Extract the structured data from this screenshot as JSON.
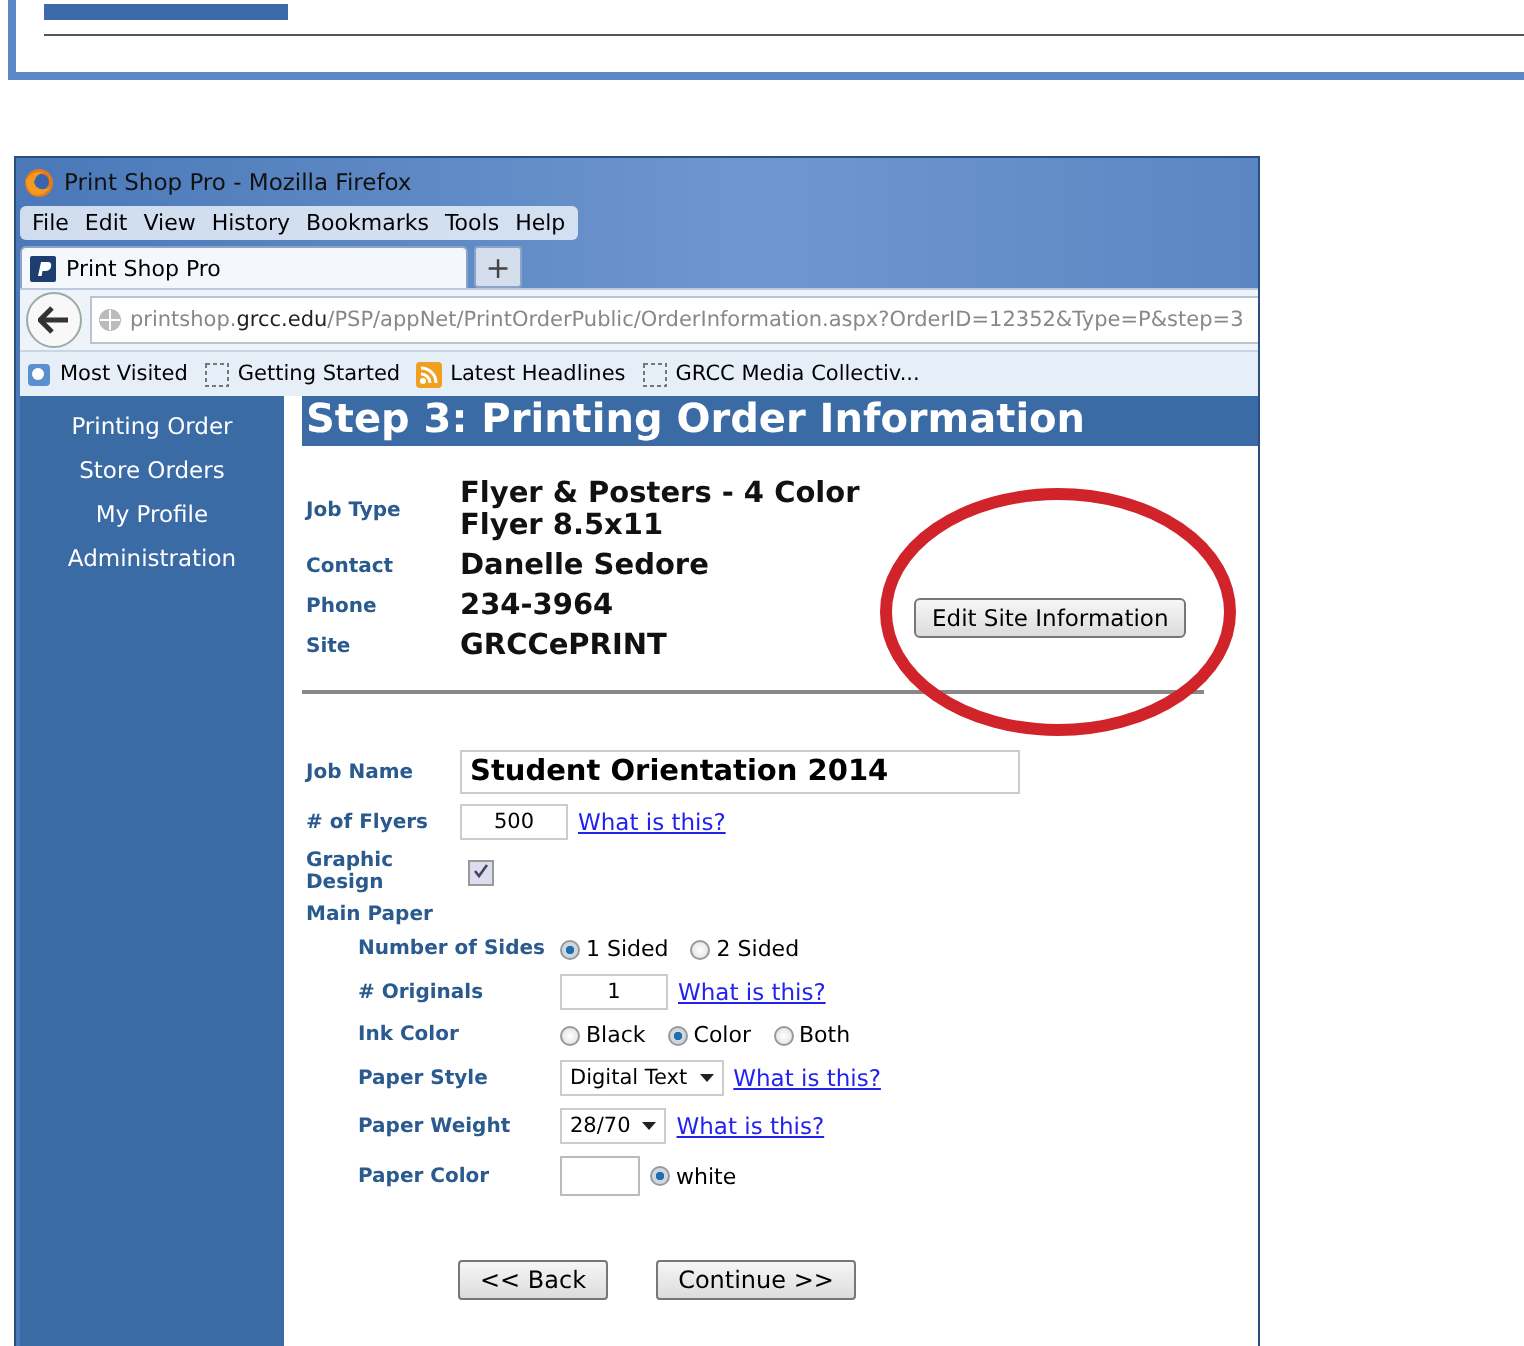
{
  "window": {
    "title": "Print Shop Pro - Mozilla Firefox"
  },
  "menu": [
    {
      "label": "File"
    },
    {
      "label": "Edit"
    },
    {
      "label": "View"
    },
    {
      "label": "History"
    },
    {
      "label": "Bookmarks"
    },
    {
      "label": "Tools"
    },
    {
      "label": "Help"
    }
  ],
  "tabs": [
    {
      "label": "Print Shop Pro",
      "selected": true
    }
  ],
  "new_tab": "+",
  "address": {
    "prefix": "printshop.",
    "domain": "grcc.edu",
    "path": "/PSP/appNet/PrintOrderPublic/OrderInformation.aspx?OrderID=12352&Type=P&step=3"
  },
  "bookmarks": [
    {
      "label": "Most Visited",
      "kind": "site"
    },
    {
      "label": "Getting Started",
      "kind": "page"
    },
    {
      "label": "Latest Headlines",
      "kind": "feed"
    },
    {
      "label": "GRCC Media Collectiv...",
      "kind": "page"
    }
  ],
  "sidebar": {
    "items": [
      "Printing Order",
      "Store Orders",
      "My Profile",
      "Administration"
    ]
  },
  "heading": "Step 3: Printing Order Information",
  "info": [
    {
      "label": "Job Type",
      "lines": [
        "Flyer & Posters - 4 Color",
        "Flyer 8.5x11"
      ]
    },
    {
      "label": "Contact",
      "lines": [
        "Danelle Sedore"
      ]
    },
    {
      "label": "Phone",
      "lines": [
        "234-3964"
      ]
    },
    {
      "label": "Site",
      "lines": [
        "GRCCePRINT"
      ]
    }
  ],
  "edit_site_button": "Edit Site Information",
  "form": [
    {
      "kind": "big_text",
      "label": "Job Name",
      "value": "Student Orientation 2014"
    },
    {
      "kind": "number",
      "label": "# of Flyers",
      "value": "500",
      "link": "What is this?"
    },
    {
      "kind": "checkbox",
      "label": "Graphic Design",
      "checked": true
    },
    {
      "kind": "section",
      "label": "Main Paper",
      "children": [
        {
          "kind": "radio",
          "label": "Number of Sides",
          "options": [
            {
              "label": "1 Sided",
              "selected": true
            },
            {
              "label": "2 Sided",
              "selected": false
            }
          ]
        },
        {
          "kind": "number",
          "label": "# Originals",
          "value": "1",
          "link": "What is this?"
        },
        {
          "kind": "radio",
          "label": "Ink Color",
          "options": [
            {
              "label": "Black",
              "selected": false
            },
            {
              "label": "Color",
              "selected": true
            },
            {
              "label": "Both",
              "selected": false
            }
          ]
        },
        {
          "kind": "select",
          "label": "Paper Style",
          "value": "Digital Text",
          "link": "What is this?"
        },
        {
          "kind": "select",
          "label": "Paper Weight",
          "value": "28/70",
          "link": "What is this?"
        },
        {
          "kind": "color",
          "label": "Paper Color",
          "options": [
            {
              "label": "white",
              "selected": true
            }
          ]
        }
      ]
    }
  ],
  "buttons": [
    "<< Back",
    "Continue >>"
  ]
}
